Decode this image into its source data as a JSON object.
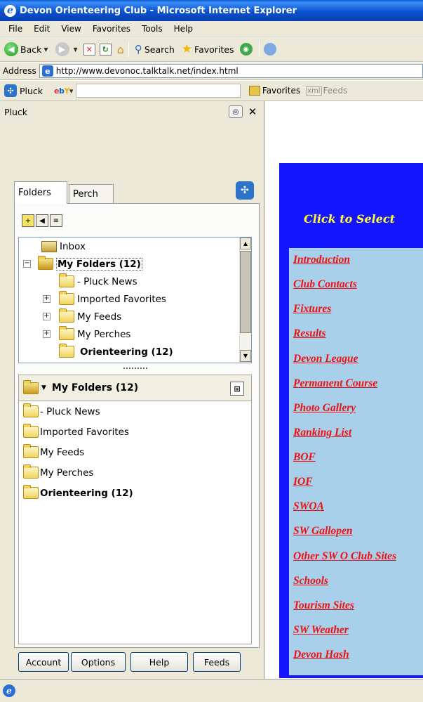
{
  "window": {
    "title": "Devon Orienteering Club - Microsoft Internet Explorer"
  },
  "menu": [
    "File",
    "Edit",
    "View",
    "Favorites",
    "Tools",
    "Help"
  ],
  "toolbar": {
    "back": "Back",
    "search": "Search",
    "favorites": "Favorites"
  },
  "address": {
    "label": "Address",
    "url": "http://www.devonoc.talktalk.net/index.html"
  },
  "pluck_bar": {
    "label": "Pluck",
    "favorites": "Favorites",
    "feeds": "Feeds"
  },
  "pluck_panel": {
    "title": "Pluck",
    "tabs": [
      "Folders",
      "Perch"
    ],
    "tree": [
      {
        "label": "Inbox",
        "bold": false,
        "expander": ""
      },
      {
        "label": "My Folders (12)",
        "bold": true,
        "expander": "−"
      },
      {
        "label": "- Pluck News",
        "bold": false,
        "expander": ""
      },
      {
        "label": "Imported Favorites",
        "bold": false,
        "expander": "+"
      },
      {
        "label": "My Feeds",
        "bold": false,
        "expander": "+"
      },
      {
        "label": "My Perches",
        "bold": false,
        "expander": "+"
      },
      {
        "label": "Orienteering (12)",
        "bold": true,
        "expander": ""
      }
    ],
    "list_header": "My Folders (12)",
    "list": [
      {
        "label": "- Pluck News",
        "bold": false
      },
      {
        "label": "Imported Favorites",
        "bold": false
      },
      {
        "label": "My Feeds",
        "bold": false
      },
      {
        "label": "My Perches",
        "bold": false
      },
      {
        "label": "Orienteering (12)",
        "bold": true
      }
    ],
    "buttons": [
      "Account",
      "Options",
      "Help",
      "Feeds"
    ]
  },
  "page": {
    "heading": "Click to Select",
    "links": [
      "Introduction",
      "Club Contacts",
      "Fixtures",
      "Results",
      "Devon League",
      "Permanent Course",
      "Photo Gallery",
      "Ranking List",
      "BOF",
      "IOF",
      "SWOA",
      "SW Gallopen",
      "Other SW O Club Sites",
      "Schools",
      "Tourism Sites",
      "SW Weather",
      "Devon Hash"
    ]
  }
}
